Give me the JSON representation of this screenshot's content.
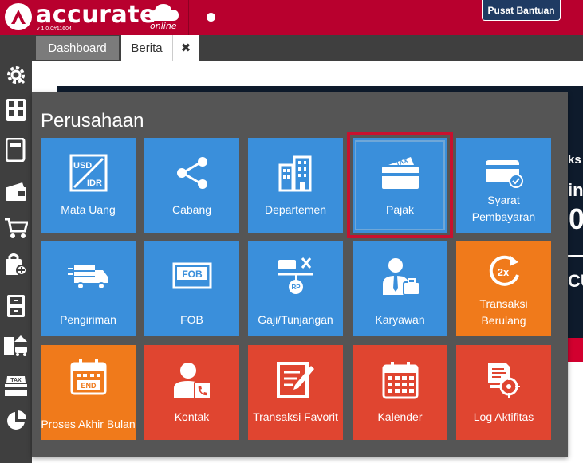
{
  "header": {
    "brand_name": "accurate",
    "brand_sub": "online",
    "version": "v 1.0.0#11604",
    "help_label": "Pusat Bantuan",
    "accent": "#b8002e"
  },
  "tabs": [
    {
      "label": "Dashboard"
    },
    {
      "label": "Berita"
    },
    {
      "label": "✖"
    }
  ],
  "panel": {
    "title": "Perusahaan",
    "tiles": [
      {
        "label": "Mata Uang",
        "color": "blue",
        "icon": "currency-usd-idr-icon"
      },
      {
        "label": "Cabang",
        "color": "blue",
        "icon": "branch-share-icon"
      },
      {
        "label": "Departemen",
        "color": "blue",
        "icon": "building-icon"
      },
      {
        "label": "Pajak",
        "color": "blue",
        "icon": "tax-card-icon",
        "selected": true
      },
      {
        "label": "Syarat Pembayaran",
        "color": "blue",
        "icon": "credit-card-check-icon"
      },
      {
        "label": "Pengiriman",
        "color": "blue",
        "icon": "delivery-truck-icon"
      },
      {
        "label": "FOB",
        "color": "blue",
        "icon": "fob-sign-icon"
      },
      {
        "label": "Gaji/Tunjangan",
        "color": "blue",
        "icon": "salary-scale-icon"
      },
      {
        "label": "Karyawan",
        "color": "blue",
        "icon": "employee-briefcase-icon"
      },
      {
        "label": "Transaksi Berulang",
        "color": "orange",
        "icon": "repeat-2x-icon"
      },
      {
        "label": "Proses Akhir Bulan",
        "color": "orange",
        "icon": "calendar-end-icon"
      },
      {
        "label": "Kontak",
        "color": "red",
        "icon": "contact-phone-icon"
      },
      {
        "label": "Transaksi Favorit",
        "color": "red",
        "icon": "favorite-edit-icon"
      },
      {
        "label": "Kalender",
        "color": "red",
        "icon": "calendar-icon"
      },
      {
        "label": "Log Aktifitas",
        "color": "red",
        "icon": "activity-log-icon"
      }
    ]
  },
  "background": {
    "text_ks": "ks",
    "text_in": "in",
    "text_0": "0",
    "text_cu": "CU"
  }
}
